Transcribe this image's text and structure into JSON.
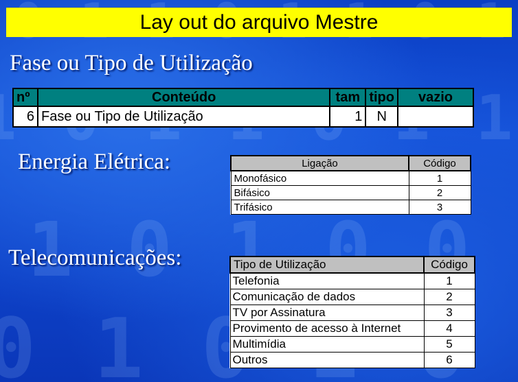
{
  "title": "Lay out do arquivo Mestre",
  "section1": {
    "heading": "Fase ou Tipo de Utilização",
    "headers": [
      "nº",
      "Conteúdo",
      "tam",
      "tipo",
      "vazio"
    ],
    "row": {
      "num": "6",
      "content": "Fase ou Tipo de Utilização",
      "tam": "1",
      "tipo": "N",
      "vazio": ""
    }
  },
  "section2": {
    "heading": "Energia Elétrica:",
    "headers": [
      "Ligação",
      "Código"
    ],
    "rows": [
      {
        "label": "Monofásico",
        "code": "1"
      },
      {
        "label": "Bifásico",
        "code": "2"
      },
      {
        "label": "Trifásico",
        "code": "3"
      }
    ]
  },
  "section3": {
    "heading": "Telecomunicações:",
    "headers": [
      "Tipo de Utilização",
      "Código"
    ],
    "rows": [
      {
        "label": "Telefonia",
        "code": "1"
      },
      {
        "label": "Comunicação de dados",
        "code": "2"
      },
      {
        "label": "TV por Assinatura",
        "code": "3"
      },
      {
        "label": "Provimento de acesso à Internet",
        "code": "4"
      },
      {
        "label": "Multimídia",
        "code": "5"
      },
      {
        "label": "Outros",
        "code": "6"
      }
    ]
  }
}
